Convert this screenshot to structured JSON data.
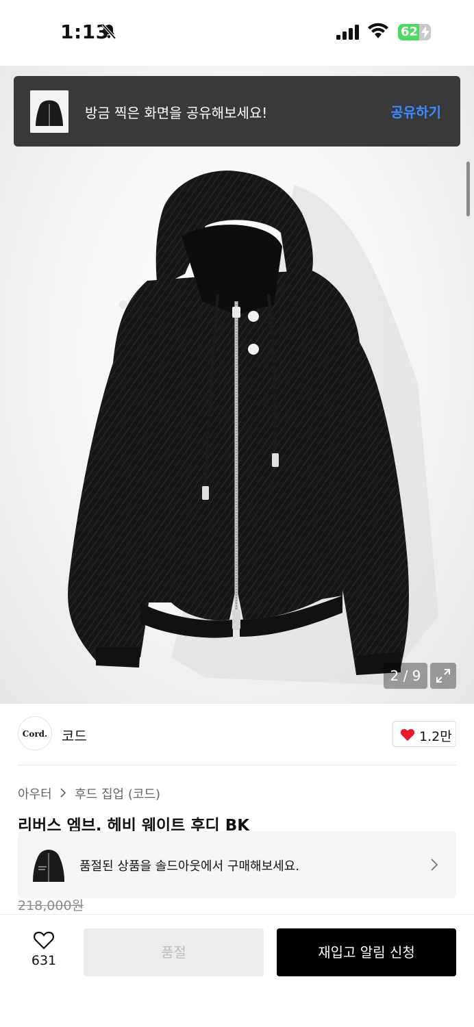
{
  "status_bar": {
    "time": "1:13",
    "battery": "62"
  },
  "share_toast": {
    "message": "방금 찍은 화면을 공유해보세요!",
    "action": "공유하기"
  },
  "gallery": {
    "counter": "2 / 9",
    "current": 2,
    "total": 9
  },
  "brand": {
    "logo_text": "Cord.",
    "name": "코드",
    "likes": "1.2만"
  },
  "breadcrumb": {
    "category": "아우터",
    "subcategory": "후드 집업 (코드)"
  },
  "product": {
    "title": "리버스 엠브. 헤비 웨이트 후디  BK",
    "price": "218,000원"
  },
  "soldout_banner": {
    "message": "품절된 상품을 솔드아웃에서 구매해보세요."
  },
  "bottom_bar": {
    "wish_count": "631",
    "soldout_label": "품절",
    "restock_label": "재입고 알림 신청"
  },
  "colors": {
    "accent_blue": "#3d8bff",
    "toast_bg": "#38393b",
    "heart_red": "#e8192c",
    "battery_green": "#4cd964"
  }
}
